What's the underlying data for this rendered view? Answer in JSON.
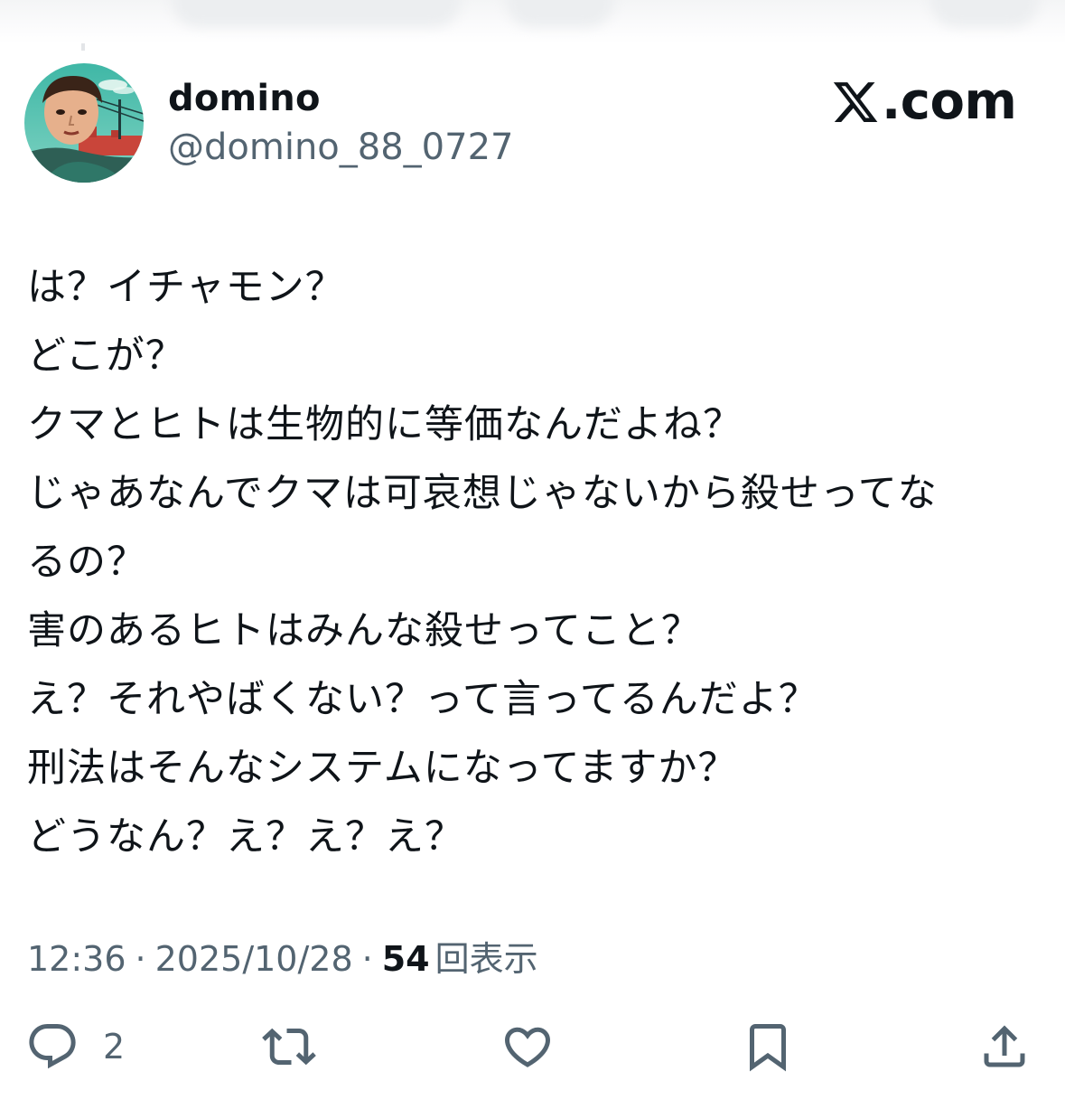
{
  "author": {
    "display_name": "domino",
    "handle": "@domino_88_0727"
  },
  "brand": {
    "logo_icon": "x-logo-icon",
    "suffix": ".com"
  },
  "tweet": {
    "lines": [
      "は？イチャモン？",
      "どこが？",
      "クマとヒトは生物的に等価なんだよね？",
      "じゃあなんでクマは可哀想じゃないから殺せってな",
      "るの？",
      "害のあるヒトはみんな殺せってこと？",
      "え？それやばくない？って言ってるんだよ？",
      "刑法はそんなシステムになってますか？",
      "どうなん？え？え？え？"
    ]
  },
  "meta": {
    "time": "12:36",
    "separator": "·",
    "date": "2025/10/28",
    "views_count": "54",
    "views_label": "回表示"
  },
  "actions": {
    "reply": {
      "icon": "reply-icon",
      "count": "2"
    },
    "repost": {
      "icon": "repost-icon"
    },
    "like": {
      "icon": "heart-icon"
    },
    "bookmark": {
      "icon": "bookmark-icon"
    },
    "share": {
      "icon": "share-icon"
    }
  },
  "colors": {
    "text_primary": "#0f1419",
    "text_secondary": "#536471",
    "background": "#ffffff"
  }
}
